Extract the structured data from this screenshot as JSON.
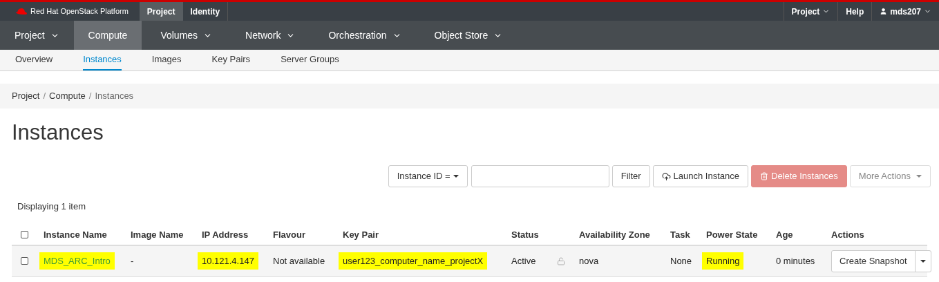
{
  "brand": {
    "name": "Red Hat OpenStack Platform"
  },
  "top_tabs": [
    {
      "label": "Project",
      "selected": true
    },
    {
      "label": "Identity",
      "selected": false
    }
  ],
  "top_right": [
    {
      "label": "Project",
      "kind": "dropdown"
    },
    {
      "label": "Help",
      "kind": "link"
    },
    {
      "label": "mds207",
      "kind": "user"
    }
  ],
  "main_nav": [
    {
      "label": "Project",
      "selected": false,
      "dropdown": true
    },
    {
      "label": "Compute",
      "selected": true,
      "dropdown": false
    },
    {
      "label": "Volumes",
      "selected": false,
      "dropdown": true
    },
    {
      "label": "Network",
      "selected": false,
      "dropdown": true
    },
    {
      "label": "Orchestration",
      "selected": false,
      "dropdown": true
    },
    {
      "label": "Object Store",
      "selected": false,
      "dropdown": true
    }
  ],
  "sub_nav": [
    {
      "label": "Overview",
      "selected": false
    },
    {
      "label": "Instances",
      "selected": true
    },
    {
      "label": "Images",
      "selected": false
    },
    {
      "label": "Key Pairs",
      "selected": false
    },
    {
      "label": "Server Groups",
      "selected": false
    }
  ],
  "breadcrumb": {
    "separator": "/",
    "items": [
      "Project",
      "Compute",
      "Instances"
    ]
  },
  "page_title": "Instances",
  "toolbar": {
    "filter_select": "Instance ID =",
    "buttons": [
      {
        "label": "Filter",
        "kind": "default",
        "disabled": false
      },
      {
        "label": "Launch Instance",
        "kind": "launch",
        "disabled": false
      },
      {
        "label": "Delete Instances",
        "kind": "danger",
        "disabled": true
      },
      {
        "label": "More Actions",
        "kind": "more",
        "disabled": true
      }
    ]
  },
  "count_label": "Displaying 1 item",
  "table": {
    "select_all_checked": false,
    "columns": [
      "Instance Name",
      "Image Name",
      "IP Address",
      "Flavour",
      "Key Pair",
      "Status",
      "Availability Zone",
      "Task",
      "Power State",
      "Age",
      "Actions"
    ],
    "rows": [
      {
        "checked": false,
        "cells": [
          {
            "text": "MDS_ARC_Intro",
            "kind": "link",
            "highlighted": true
          },
          {
            "text": "-",
            "kind": "text",
            "highlighted": false
          },
          {
            "text": "10.121.4.147",
            "kind": "text",
            "highlighted": true
          },
          {
            "text": "Not available",
            "kind": "text",
            "highlighted": false
          },
          {
            "text": "user123_computer_name_projectX",
            "kind": "text",
            "highlighted": true
          },
          {
            "text": "Active",
            "kind": "status",
            "highlighted": false
          },
          {
            "text": "nova",
            "kind": "text",
            "highlighted": false
          },
          {
            "text": "None",
            "kind": "text",
            "highlighted": false
          },
          {
            "text": "Running",
            "kind": "text",
            "highlighted": true
          },
          {
            "text": "0 minutes",
            "kind": "text",
            "highlighted": false
          }
        ],
        "action": "Create Snapshot"
      }
    ]
  }
}
